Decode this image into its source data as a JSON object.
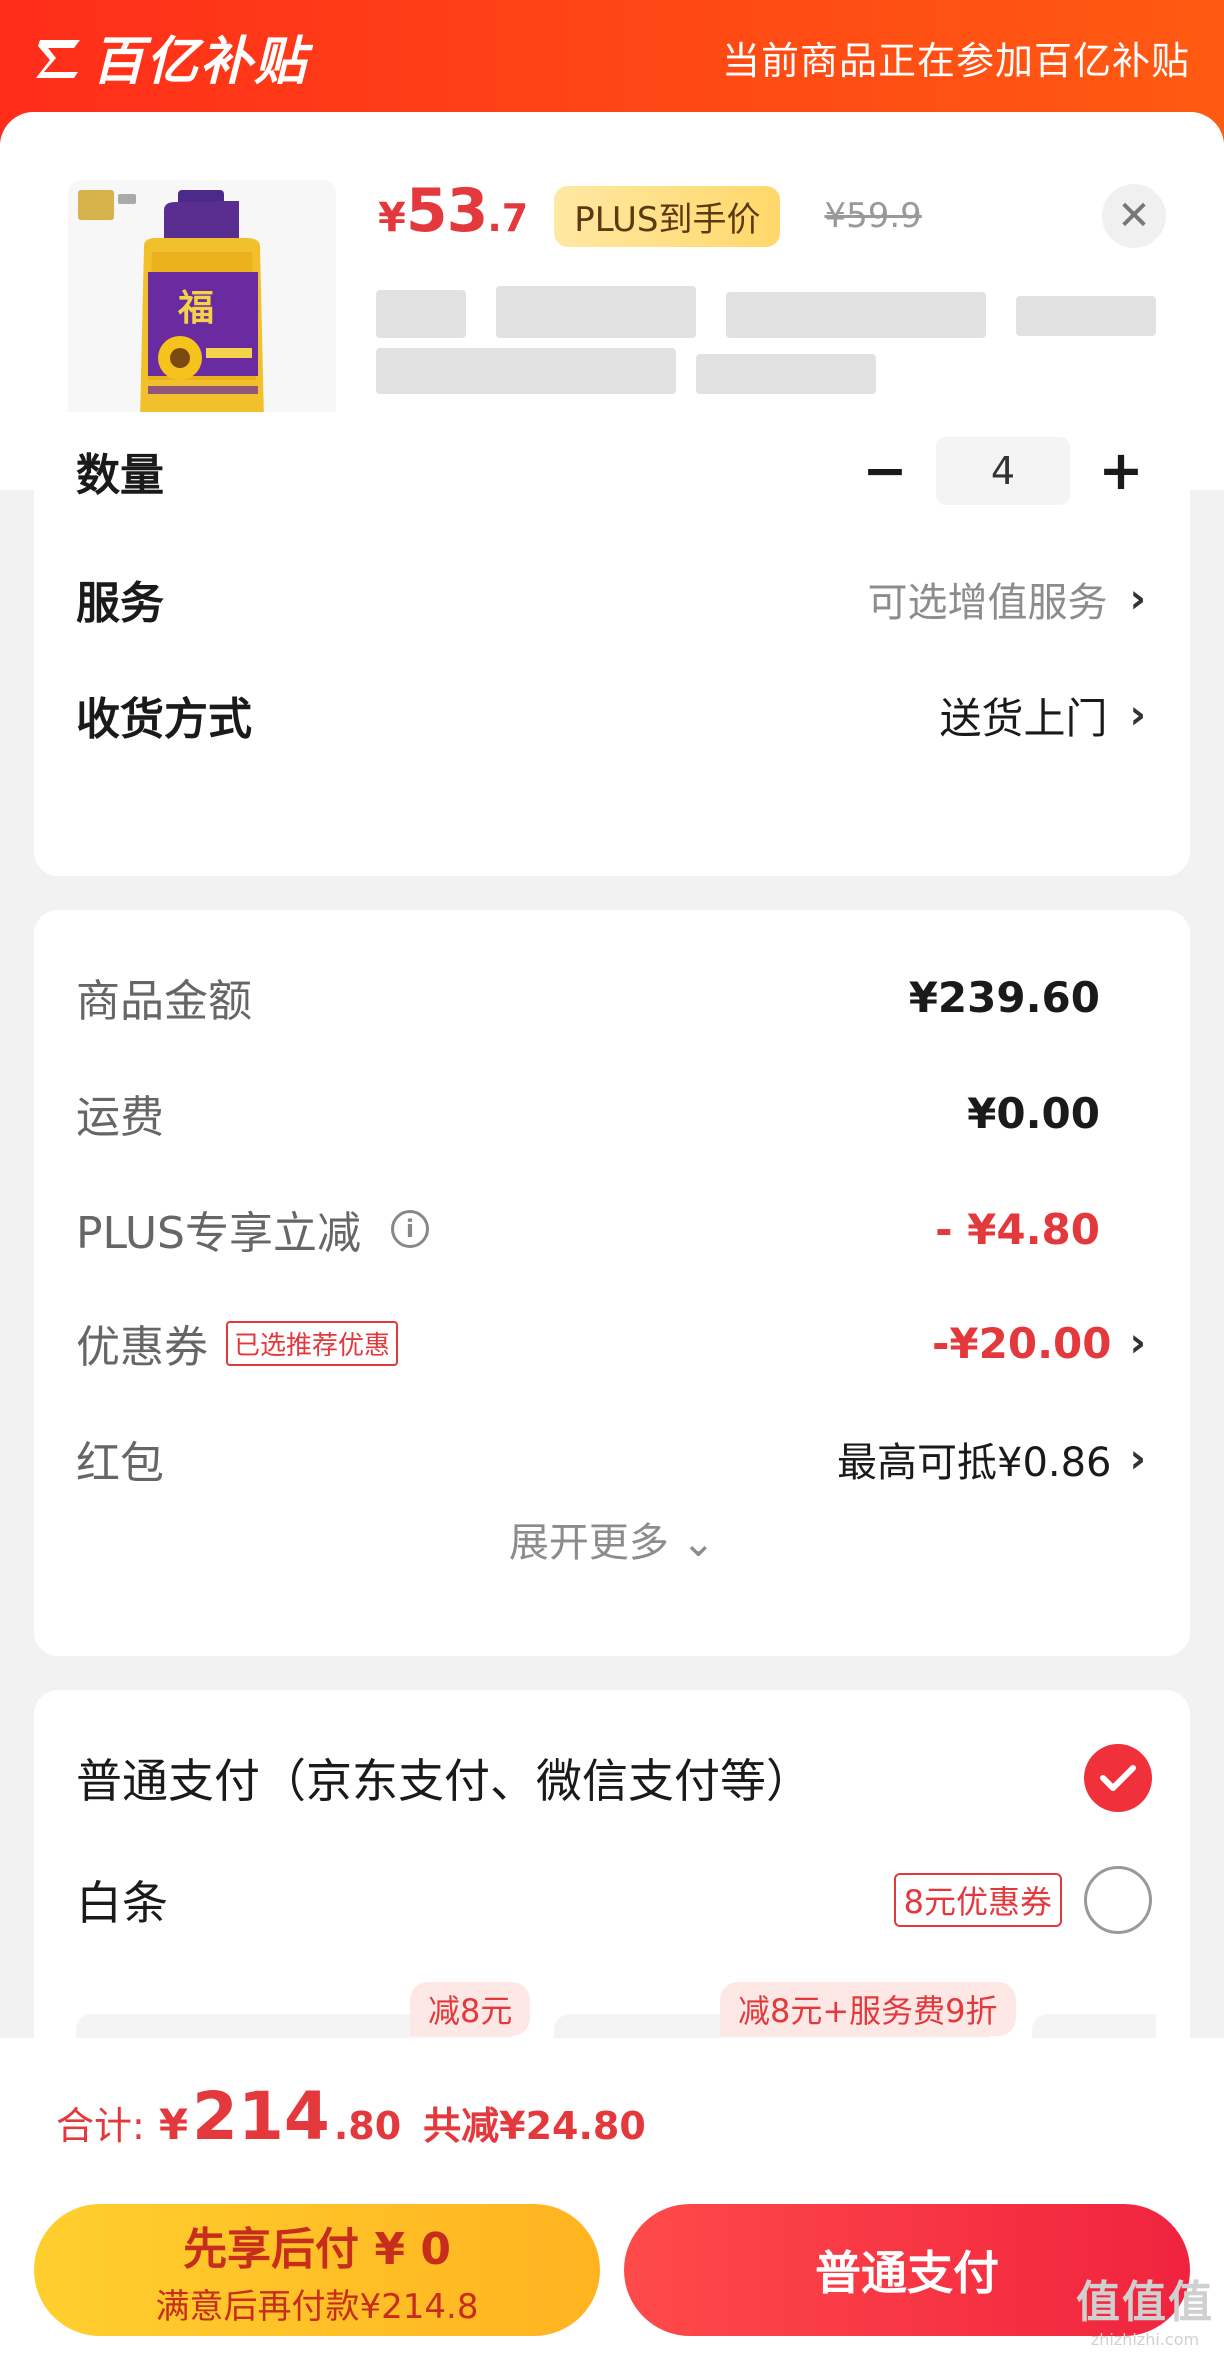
{
  "banner": {
    "brand": "百亿补贴",
    "note": "当前商品正在参加百亿补贴"
  },
  "product": {
    "price_symbol": "¥",
    "price_int": "53",
    "price_dec": ".7",
    "plus_tag": "PLUS到手价",
    "orig_price": "¥59.9",
    "close_icon": "close-icon"
  },
  "options": {
    "quantity_label": "数量",
    "quantity_value": "4",
    "minus": "−",
    "plus": "+",
    "service_label": "服务",
    "service_value": "可选增值服务",
    "delivery_label": "收货方式",
    "delivery_value": "送货上门",
    "chevron": "›"
  },
  "amounts": {
    "goods_label": "商品金额",
    "goods_value": "¥239.60",
    "shipping_label": "运费",
    "shipping_value": "¥0.00",
    "plus_label": "PLUS专享立减",
    "plus_value": "- ¥4.80",
    "coupon_label": "优惠券",
    "coupon_tag": "已选推荐优惠",
    "coupon_value": "-¥20.00",
    "hongbao_label": "红包",
    "hongbao_value": "最高可抵¥0.86",
    "expand": "展开更多"
  },
  "payment": {
    "normal_label": "普通支付（京东支付、微信支付等）",
    "baitiao_label": "白条",
    "baitiao_tag": "8元优惠券",
    "install_badge_1": "减8元",
    "install_badge_2": "减8元+服务费9折"
  },
  "bottom": {
    "total_label": "合计:",
    "total_sym": "¥",
    "total_int": "214",
    "total_dec": ".80",
    "total_saved": "共减¥24.80",
    "later_main": "先享后付 ¥ 0",
    "later_sub": "满意后再付款¥214.8",
    "normal_btn": "普通支付"
  },
  "watermark": {
    "main": "值值值",
    "sub": "zhizhizhi.com"
  },
  "colors": {
    "accent_red": "#e4393c",
    "banner_orange": "#ff4a14",
    "later_yellow": "#ffc028"
  }
}
